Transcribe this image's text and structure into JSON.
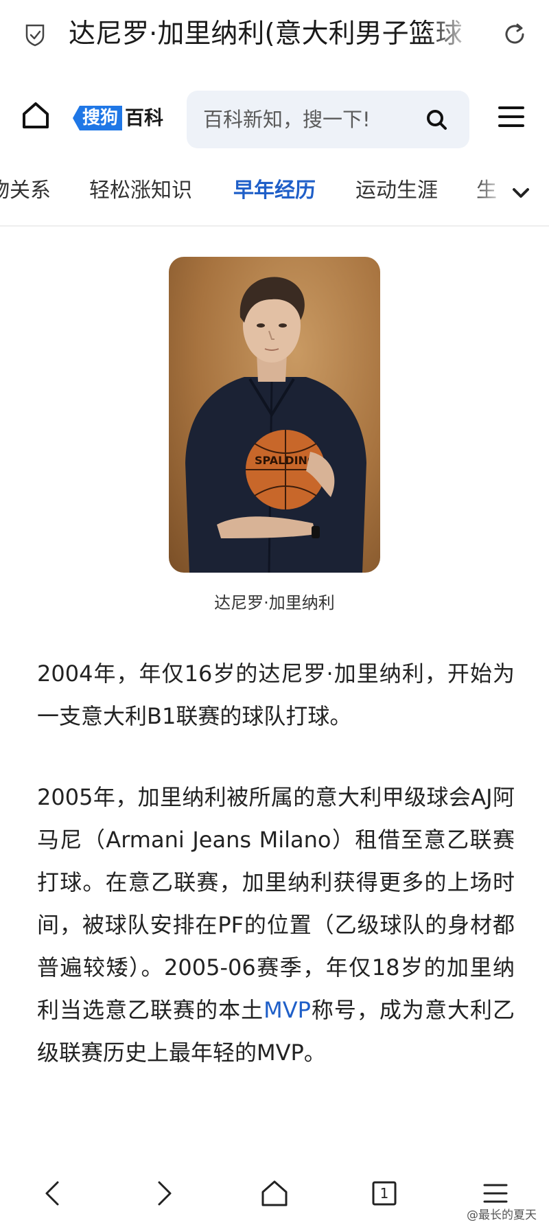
{
  "browser": {
    "title": "达尼罗·加里纳利(意大利男子篮球"
  },
  "header": {
    "logo_tag": "搜狗",
    "logo_text": "百科",
    "search_placeholder": "百科新知，搜一下!"
  },
  "tabs": [
    {
      "label": "物关系",
      "active": false
    },
    {
      "label": "轻松涨知识",
      "active": false
    },
    {
      "label": "早年经历",
      "active": true
    },
    {
      "label": "运动生涯",
      "active": false
    },
    {
      "label": "生",
      "active": false
    }
  ],
  "figure": {
    "image_alt": "达尼罗·加里纳利",
    "caption": "达尼罗·加里纳利",
    "ball_text": "SPALDING"
  },
  "article": {
    "p1": "2004年，年仅16岁的达尼罗·加里纳利，开始为一支意大利B1联赛的球队打球。",
    "p2_a": "2005年，加里纳利被所属的意大利甲级球会AJ阿马尼（Armani Jeans Milano）租借至意乙联赛打球。在意乙联赛，加里纳利获得更多的上场时间，被球队安排在PF的位置（乙级球队的身材都普遍较矮）。2005-06赛季，年仅18岁的加里纳利当选意乙联赛的本土",
    "p2_link": "MVP",
    "p2_b": "称号，成为意大利乙级联赛历史上最年轻的MVP。"
  },
  "bottom_nav": {
    "tab_count": "1"
  },
  "watermark": "@最长的夏天",
  "colors": {
    "accent": "#1f5fc8",
    "logo_blue": "#1f77e6",
    "search_bg": "#eef2f8"
  }
}
